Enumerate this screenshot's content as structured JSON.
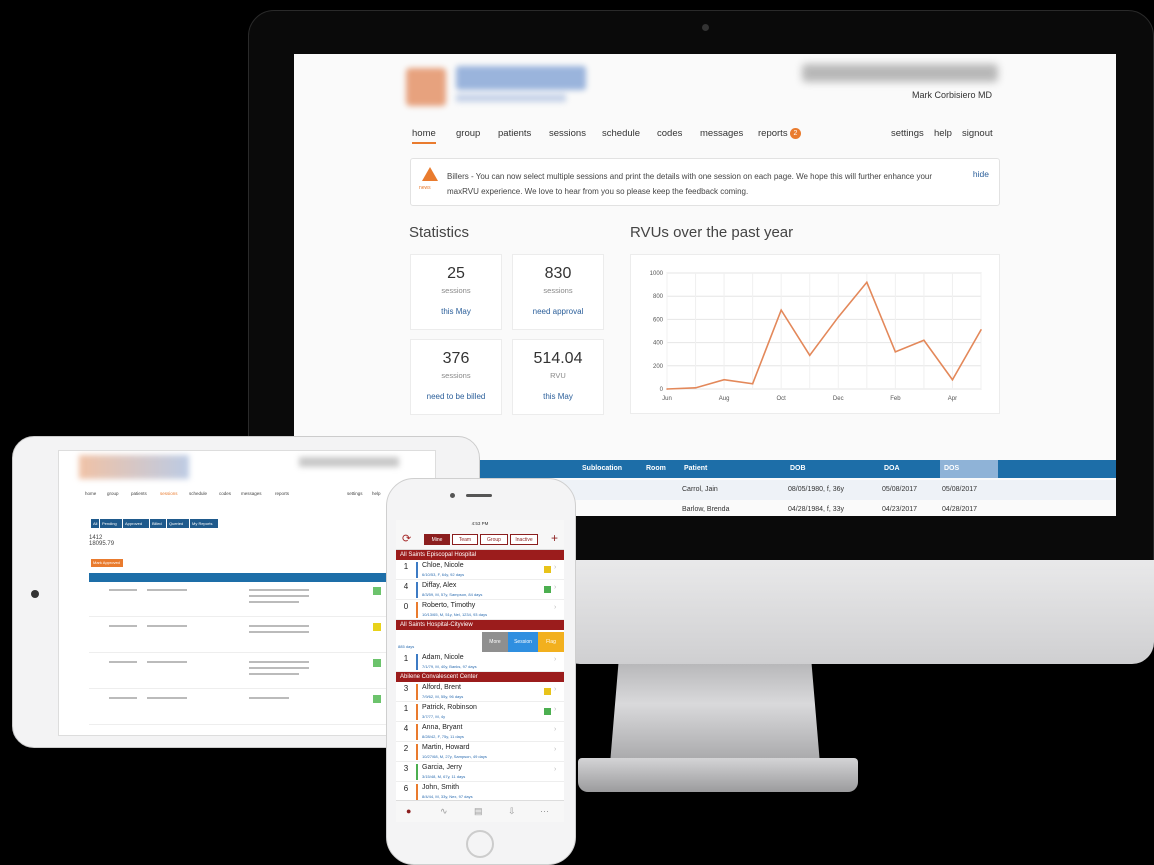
{
  "desktop": {
    "user_name": "Mark Corbisiero MD",
    "nav": {
      "home": "home",
      "group": "group",
      "patients": "patients",
      "sessions": "sessions",
      "schedule": "schedule",
      "codes": "codes",
      "messages": "messages",
      "reports": "reports",
      "reports_badge": "2",
      "settings": "settings",
      "help": "help",
      "signout": "signout"
    },
    "notice": {
      "icon_label": "news",
      "line1": "Billers - You can now select multiple sessions and print the details with one session on each page. We hope this will further enhance your",
      "line2": "maxRVU experience. We love to hear from you so please keep the feedback coming.",
      "hide": "hide"
    },
    "statistics_title": "Statistics",
    "stats": [
      {
        "value": "25",
        "unit": "sessions",
        "caption": "this May"
      },
      {
        "value": "830",
        "unit": "sessions",
        "caption": "need approval"
      },
      {
        "value": "376",
        "unit": "sessions",
        "caption": "need to be billed"
      },
      {
        "value": "514.04",
        "unit": "RVU",
        "caption": "this May"
      }
    ],
    "rvu_title": "RVUs over the past year",
    "table_title_fragment": "ts",
    "table_headers": [
      "Sublocation",
      "Room",
      "Patient",
      "DOB",
      "DOA",
      "DOS"
    ],
    "table_rows": [
      {
        "patient": "Carrol, Jain",
        "dob": "08/05/1980, f, 36y",
        "doa": "05/08/2017",
        "dos": "05/08/2017"
      },
      {
        "patient": "Barlow, Brenda",
        "dob": "04/28/1984, f, 33y",
        "doa": "04/23/2017",
        "dos": "04/28/2017"
      }
    ]
  },
  "chart_data": {
    "type": "line",
    "title": "RVUs over the past year",
    "x": [
      "Jun",
      "Jul",
      "Aug",
      "Sep",
      "Oct",
      "Nov",
      "Dec",
      "Jan",
      "Feb",
      "Mar",
      "Apr",
      "May"
    ],
    "tick_labels_x": [
      "Jun",
      "Aug",
      "Oct",
      "Dec",
      "Feb",
      "Apr"
    ],
    "series": [
      {
        "values": [
          0,
          10,
          80,
          45,
          680,
          290,
          620,
          920,
          320,
          420,
          80,
          510
        ]
      }
    ],
    "ylim": [
      0,
      1000
    ],
    "yticks": [
      0,
      200,
      400,
      600,
      800,
      1000
    ],
    "grid": true,
    "color": "#e3885a"
  },
  "tablet": {
    "nav": [
      "home",
      "group",
      "patients",
      "sessions",
      "schedule",
      "codes",
      "messages",
      "reports",
      "settings",
      "help"
    ],
    "tabs": [
      "All",
      "Pending",
      "Approved",
      "Billed",
      "Queried",
      "My Reports"
    ],
    "count_line": "1412",
    "rvu_line": "18095.79",
    "mark_button": "Mark Approved"
  },
  "phone": {
    "status_time": "4:53 PM",
    "segments": [
      "Mine",
      "Team",
      "Group",
      "Inactive"
    ],
    "groups": [
      "All Saints Episcopal Hospital",
      "All Saints Hospital-Cityview",
      "Abilene Convalescent Center"
    ],
    "patients_group1": [
      {
        "count": "1",
        "name": "Chloe, Nicole",
        "sub": "6/10/53, F, 64y, 92 days",
        "flag": "#e8c31a",
        "bar": "#3d7bc4"
      },
      {
        "count": "4",
        "name": "Diffay, Alex",
        "sub": "8/3/59, M, 57y, Sampson, 84 days",
        "flag": "#4caf50",
        "bar": "#3d7bc4"
      },
      {
        "count": "0",
        "name": "Roberto, Timothy",
        "sub": "10/13/65, M, 51y, Nel, 1234, 93 days",
        "flag": "",
        "bar": "#e97b2e"
      }
    ],
    "swipe_actions": [
      "More",
      "Session",
      "Flag"
    ],
    "swipe_sub": "885 days",
    "patients_group2": [
      {
        "count": "1",
        "name": "Adam, Nicole",
        "sub": "7/1/79, M, 40y, Banks, 97 days",
        "flag": "",
        "bar": "#3d7bc4"
      }
    ],
    "patients_group3": [
      {
        "count": "3",
        "name": "Alford, Brent",
        "sub": "7/9/62, M, 55y, 96 days",
        "flag": "#e8c31a",
        "bar": "#e97b2e"
      },
      {
        "count": "1",
        "name": "Patrick, Robinson",
        "sub": "3/7/77, M, 4y",
        "flag": "#4caf50",
        "bar": "#e97b2e"
      },
      {
        "count": "4",
        "name": "Anna, Bryant",
        "sub": "8/28/42, F, 75y, 11 days",
        "flag": "",
        "bar": "#e97b2e"
      },
      {
        "count": "2",
        "name": "Martin, Howard",
        "sub": "10/27/68, M, 27y, Sampson, 49 days",
        "flag": "",
        "bar": "#e97b2e"
      },
      {
        "count": "3",
        "name": "Garcia, Jerry",
        "sub": "3/15/48, M, 67y, 11 days",
        "flag": "",
        "bar": "#4caf50"
      },
      {
        "count": "6",
        "name": "John, Smith",
        "sub": "8/4/44, M, 33y, Nex, 97 days",
        "flag": "",
        "bar": "#e97b2e"
      }
    ]
  }
}
